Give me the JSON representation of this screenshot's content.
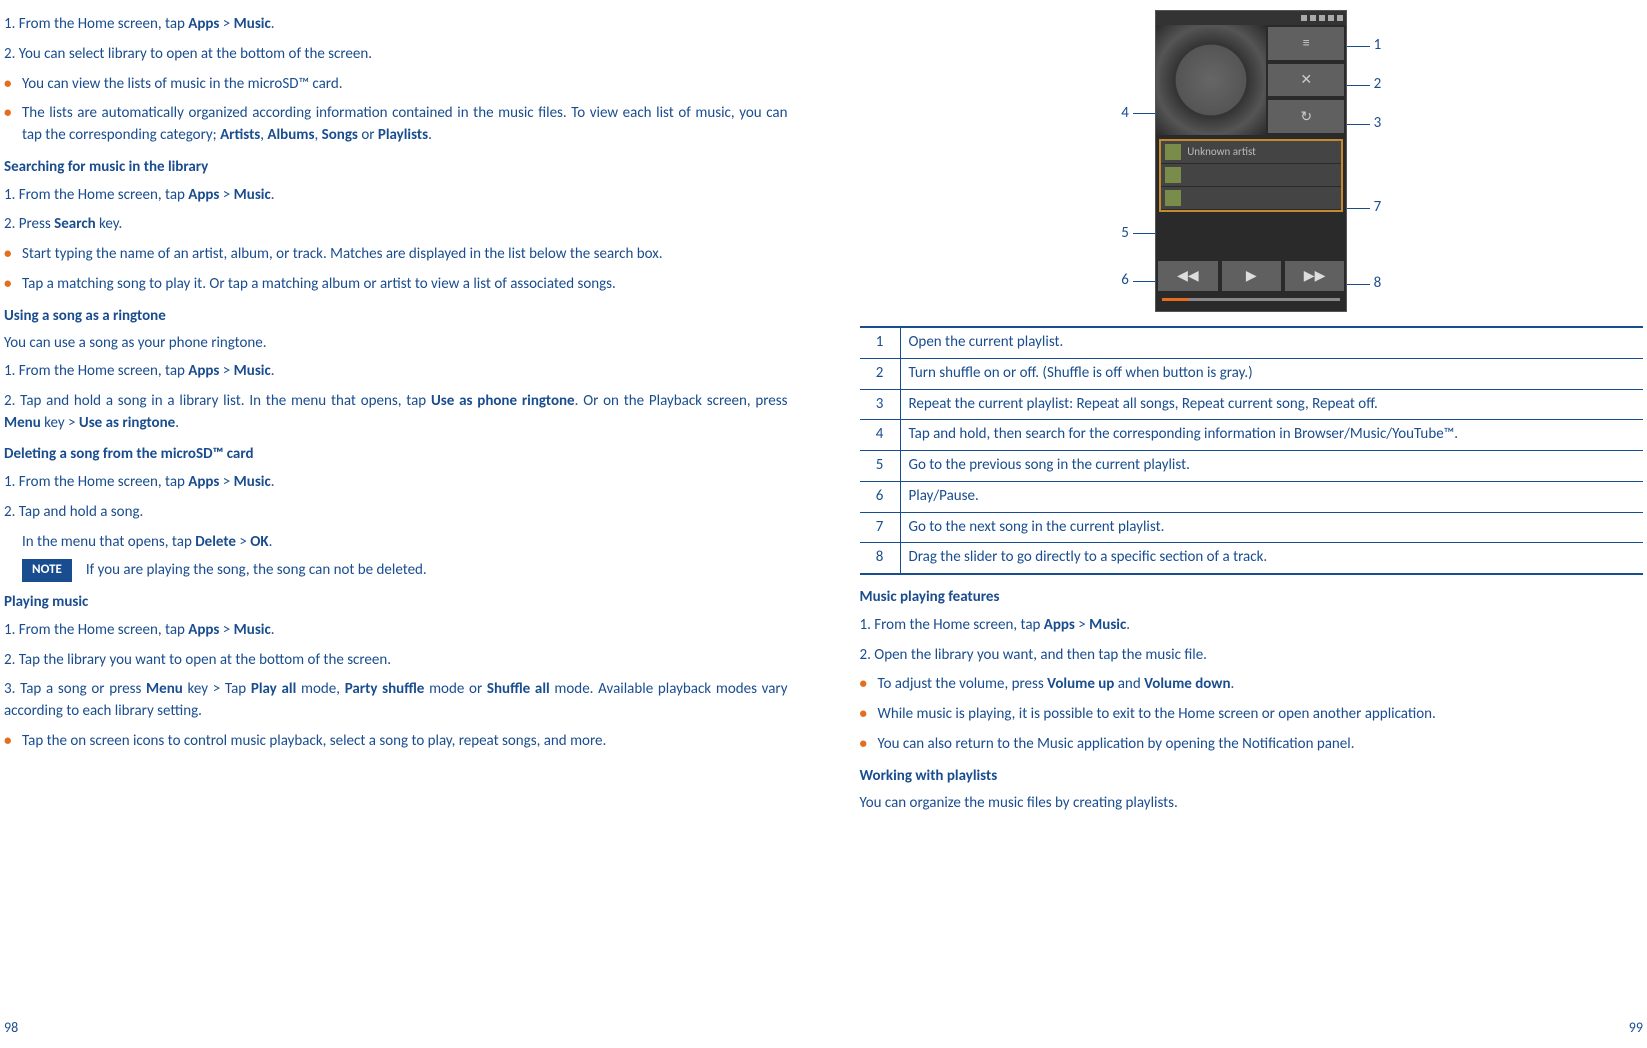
{
  "left": {
    "s1": "1. From the Home screen, tap ",
    "s1b1": "Apps",
    "s1m": " > ",
    "s1b2": "Music",
    "s1t": ".",
    "s2": "2. You can select library to open at the bottom of the screen.",
    "b1": "You can view the lists of music in the microSD™ card.",
    "b2a": "The lists are automatically organized according information contained in the music files. To view each list of music, you can tap the corresponding category; ",
    "b2b1": "Artists",
    "b2c": ", ",
    "b2b2": "Albums",
    "b2d": ", ",
    "b2b3": "Songs",
    "b2e": " or ",
    "b2b4": "Playlists",
    "b2f": ".",
    "h1": "Searching for music in the library",
    "s3": "1. From the Home screen, tap ",
    "s3b1": "Apps",
    "s3b2": "Music",
    "s4": "2. Press ",
    "s4b": "Search",
    "s4t": " key.",
    "b3": "Start typing the name of an artist, album, or track. Matches are displayed in the list below the search box.",
    "b4": "Tap a matching song to play it. Or tap a matching album or artist to view a list of associated songs.",
    "h2": "Using a song as a ringtone",
    "p1": "You can use a song as your phone ringtone.",
    "s5": "1. From the Home screen, tap ",
    "s5b1": "Apps",
    "s5b2": "Music",
    "s6a": "2. Tap and hold a song in a library list. In the menu that opens, tap ",
    "s6b1": "Use as phone ringtone",
    "s6c": ". Or on the Playback screen, press ",
    "s6b2": "Menu",
    "s6d": " key > ",
    "s6b3": "Use as ringtone",
    "s6e": ".",
    "h3": "Deleting a song from the microSD™ card",
    "s7": "1. From the Home screen, tap ",
    "s7b1": "Apps",
    "s7b2": "Music",
    "s8": "2. Tap and hold a song.",
    "s8sub": "In the menu that opens, tap ",
    "s8b1": "Delete",
    "s8b2": "OK",
    "note_label": "NOTE",
    "note_text": "If you are playing the song, the song can not be deleted.",
    "h4": "Playing music",
    "s9": "1. From the Home screen, tap ",
    "s9b1": "Apps",
    "s9b2": "Music",
    "s10": "2. Tap the library you want to open at the bottom of the screen.",
    "s11a": "3. Tap a song or press ",
    "s11b1": "Menu",
    "s11c": " key > Tap ",
    "s11b2": "Play all",
    "s11d": " mode, ",
    "s11b3": "Party shuffle",
    "s11e": " mode or ",
    "s11b4": "Shuffle all",
    "s11f": " mode. Available playback modes vary according to each library setting.",
    "b5": "Tap the on screen icons to control music playback, select a song to play, repeat songs, and more.",
    "page_num": "98"
  },
  "right": {
    "callouts": {
      "c1": "1",
      "c2": "2",
      "c3": "3",
      "c4": "4",
      "c5": "5",
      "c6": "6",
      "c7": "7",
      "c8": "8"
    },
    "phone": {
      "track1": "Unknown artist",
      "track2": "",
      "track3": ""
    },
    "legend": [
      {
        "n": "1",
        "t": "Open the current playlist."
      },
      {
        "n": "2",
        "t": "Turn shuffle on or off. (Shuffle is off when button is gray.)"
      },
      {
        "n": "3",
        "t": "Repeat the current playlist: Repeat all songs, Repeat current song, Repeat off."
      },
      {
        "n": "4",
        "t": "Tap and hold, then search for the corresponding information in Browser/Music/YouTube™."
      },
      {
        "n": "5",
        "t": "Go to the previous song in the current playlist."
      },
      {
        "n": "6",
        "t": "Play/Pause."
      },
      {
        "n": "7",
        "t": "Go to the next song in the current playlist."
      },
      {
        "n": "8",
        "t": "Drag the slider to go directly to a specific section of a track."
      }
    ],
    "h1": "Music playing features",
    "s1": "1. From the Home screen, tap ",
    "s1b1": "Apps",
    "s1b2": "Music",
    "s2": "2. Open the library you want, and then tap the music file.",
    "b1a": "To adjust the volume, press ",
    "b1b1": "Volume up",
    "b1c": " and ",
    "b1b2": "Volume down",
    "b1d": ".",
    "b2": "While music is playing, it is possible to exit to the Home screen or open another application.",
    "b3": "You can also return to the Music application by opening the Notification panel.",
    "h2": "Working with playlists",
    "p1": "You can organize the music files by creating playlists.",
    "page_num": "99"
  }
}
